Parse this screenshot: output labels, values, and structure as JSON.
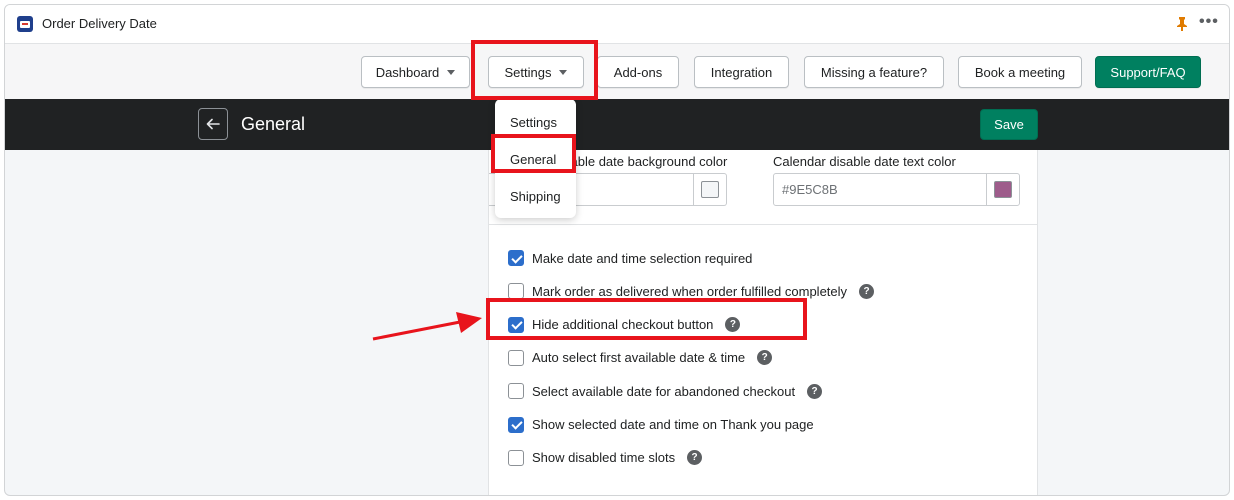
{
  "app": {
    "title": "Order Delivery Date"
  },
  "nav": {
    "dashboard": "Dashboard",
    "settings": "Settings",
    "addons": "Add-ons",
    "integration": "Integration",
    "missing": "Missing a feature?",
    "meeting": "Book a meeting",
    "support": "Support/FAQ"
  },
  "header": {
    "title": "General",
    "save": "Save"
  },
  "dropdown": {
    "items": [
      "Settings",
      "General",
      "Shipping"
    ]
  },
  "colors_section": {
    "bg_label": "sable date background color",
    "text_label": "Calendar disable date text color",
    "text_value": "#9E5C8B",
    "text_swatch": "#9E5C8B",
    "bg_swatch": "#F4F6F8"
  },
  "options": [
    {
      "label": "Make date and time selection required",
      "checked": true,
      "help": false
    },
    {
      "label": "Mark order as delivered when order fulfilled completely",
      "checked": false,
      "help": true
    },
    {
      "label": "Hide additional checkout button",
      "checked": true,
      "help": true
    },
    {
      "label": "Auto select first available date & time",
      "checked": false,
      "help": true
    },
    {
      "label": "Select available date for abandoned checkout",
      "checked": false,
      "help": true
    },
    {
      "label": "Show selected date and time on Thank you page",
      "checked": true,
      "help": false
    },
    {
      "label": "Show disabled time slots",
      "checked": false,
      "help": true
    }
  ],
  "theme": {
    "primary": "#008060",
    "checkbox": "#2C6ECB",
    "highlight": "#E8141C",
    "dark": "#202223"
  }
}
